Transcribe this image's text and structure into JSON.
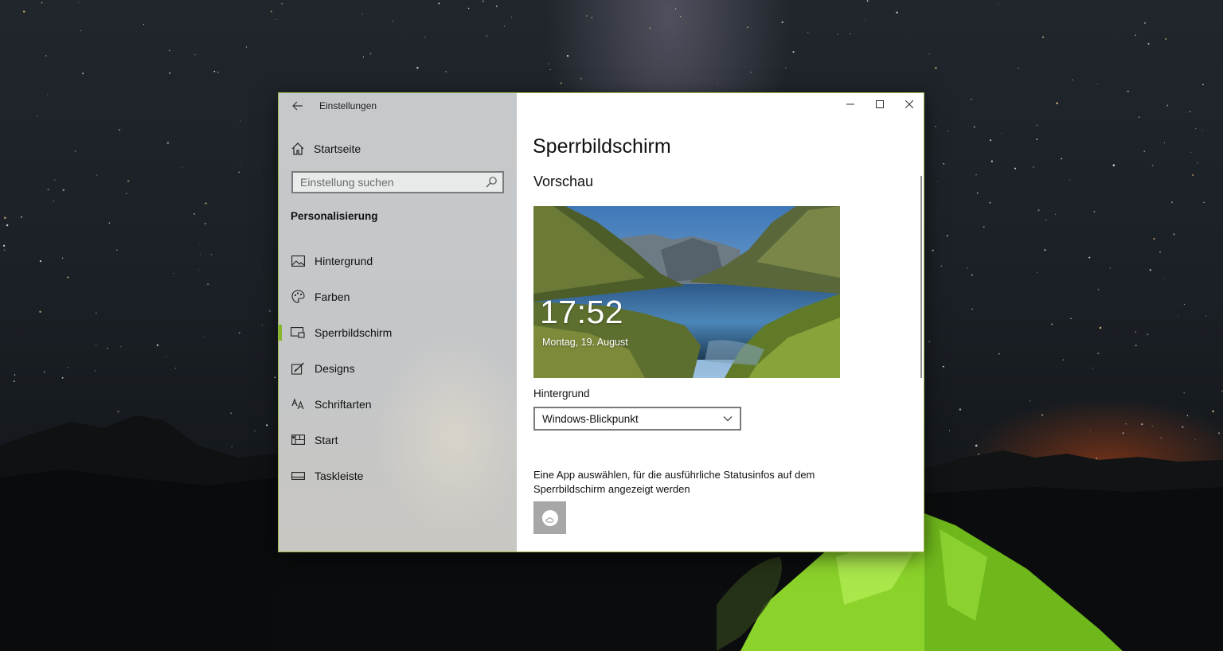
{
  "window": {
    "title": "Einstellungen",
    "controls": {
      "minimize": "–",
      "maximize": "☐",
      "close": "✕"
    }
  },
  "sidebar": {
    "home_label": "Startseite",
    "search_placeholder": "Einstellung suchen",
    "section_title": "Personalisierung",
    "items": [
      {
        "label": "Hintergrund",
        "icon": "image-icon",
        "active": false
      },
      {
        "label": "Farben",
        "icon": "palette-icon",
        "active": false
      },
      {
        "label": "Sperrbildschirm",
        "icon": "lock-screen-icon",
        "active": true
      },
      {
        "label": "Designs",
        "icon": "brush-icon",
        "active": false
      },
      {
        "label": "Schriftarten",
        "icon": "font-icon",
        "active": false
      },
      {
        "label": "Start",
        "icon": "start-menu-icon",
        "active": false
      },
      {
        "label": "Taskleiste",
        "icon": "taskbar-icon",
        "active": false
      }
    ],
    "accent_color": "#86b52a"
  },
  "main": {
    "page_title": "Sperrbildschirm",
    "preview_title": "Vorschau",
    "preview": {
      "time": "17:52",
      "date": "Montag, 19. August"
    },
    "background_label": "Hintergrund",
    "background_value": "Windows-Blickpunkt",
    "status_text": "Eine App auswählen, für die ausführliche Statusinfos auf dem Sperrbildschirm angezeigt werden",
    "status_app_icon": "weather-app-icon"
  }
}
